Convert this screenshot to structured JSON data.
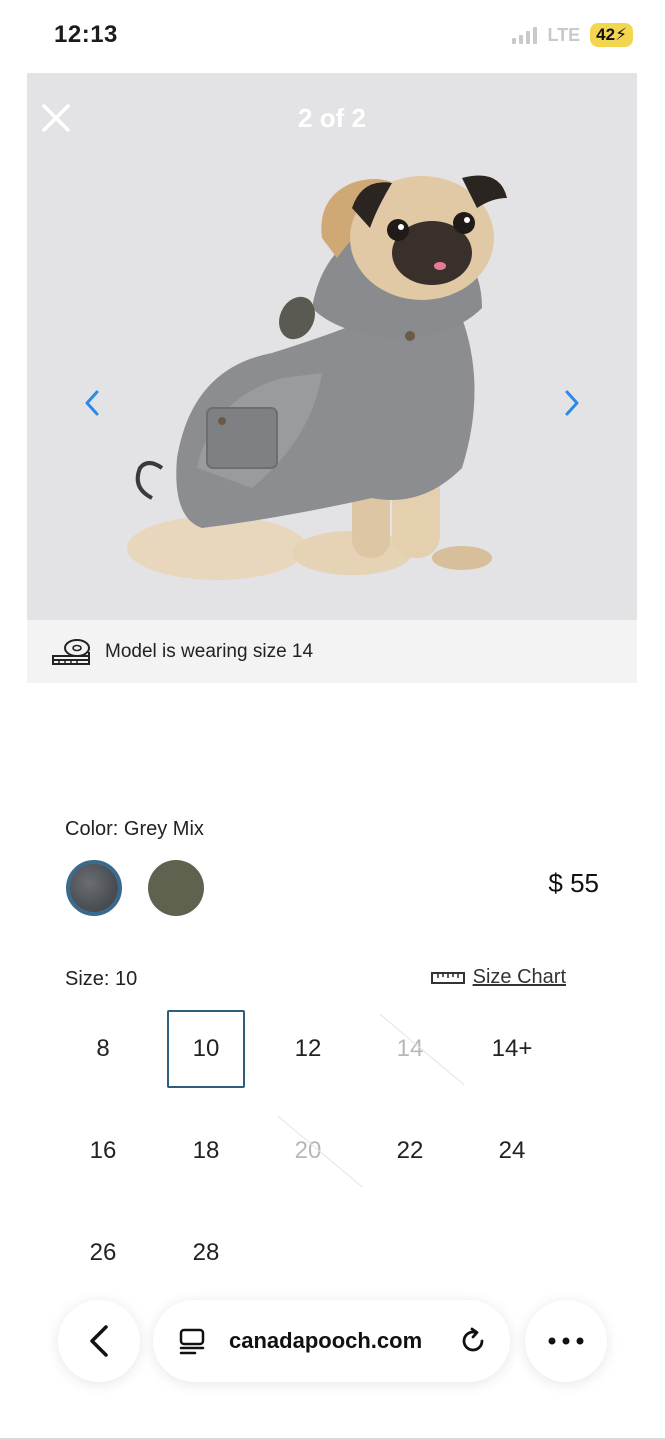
{
  "status_bar": {
    "time": "12:13",
    "network": "LTE",
    "battery": "42"
  },
  "viewer": {
    "counter": "2 of 2",
    "image_icon": "pug-in-grey-hooded-coat-photo",
    "close_icon": "close-icon",
    "prev_icon": "chevron-left-icon",
    "next_icon": "chevron-right-icon",
    "accent_color": "#2b8ae6"
  },
  "caption": {
    "text": "Model is wearing size 14",
    "icon": "measuring-tape-icon"
  },
  "product": {
    "color_label": "Color: Grey Mix",
    "colors": [
      {
        "name": "Grey Mix",
        "hex": "#505358",
        "selected": true
      },
      {
        "name": "Olive",
        "hex": "#5e624f",
        "selected": false
      }
    ],
    "price": "$ 55",
    "size_label": "Size: 10",
    "size_chart_label": "Size Chart",
    "sizes": [
      {
        "label": "8",
        "state": "available"
      },
      {
        "label": "10",
        "state": "selected"
      },
      {
        "label": "12",
        "state": "available"
      },
      {
        "label": "14",
        "state": "disabled"
      },
      {
        "label": "14+",
        "state": "available"
      },
      {
        "label": "16",
        "state": "available"
      },
      {
        "label": "18",
        "state": "available"
      },
      {
        "label": "20",
        "state": "disabled"
      },
      {
        "label": "22",
        "state": "available"
      },
      {
        "label": "24",
        "state": "available"
      },
      {
        "label": "26",
        "state": "available"
      },
      {
        "label": "28",
        "state": "available"
      }
    ]
  },
  "browser": {
    "url": "canadapooch.com",
    "back_icon": "chevron-left-icon",
    "tabs_icon": "tab-overview-icon",
    "reload_icon": "reload-icon",
    "more_icon": "more-dots-icon"
  }
}
